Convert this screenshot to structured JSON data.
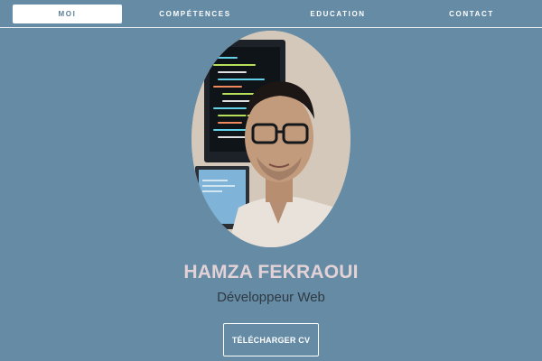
{
  "nav": {
    "items": [
      {
        "label": "MOI",
        "active": true
      },
      {
        "label": "COMPÉTENCES",
        "active": false
      },
      {
        "label": "EDUCATION",
        "active": false
      },
      {
        "label": "CONTACT",
        "active": false
      }
    ]
  },
  "hero": {
    "name": "HAMZA FEKRAOUI",
    "role": "Développeur Web",
    "cv_button_label": "TÉLÉCHARGER CV"
  },
  "colors": {
    "background": "#658ba5",
    "nav_active_bg": "#ffffff",
    "name_color": "#e2d2d6",
    "role_color": "#2f3942"
  }
}
